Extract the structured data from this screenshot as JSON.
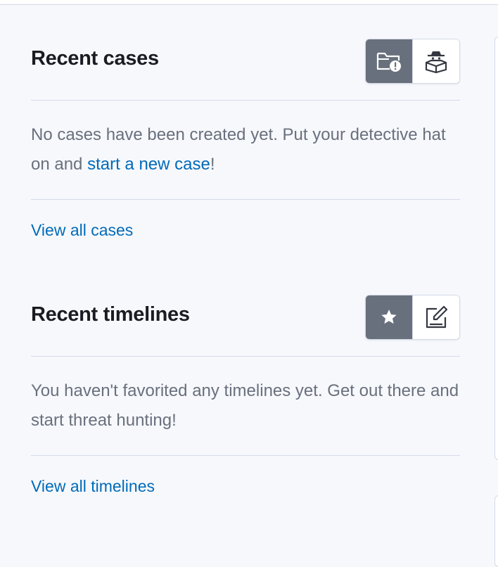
{
  "cases": {
    "title": "Recent cases",
    "buttons": [
      {
        "icon": "folder-exclamation-icon",
        "selected": true
      },
      {
        "icon": "detective-icon",
        "selected": false
      }
    ],
    "empty_text_before": "No cases have been created yet. Put your detective hat on and ",
    "empty_link": "start a new case",
    "empty_text_after": "!",
    "view_all": "View all cases"
  },
  "timelines": {
    "title": "Recent timelines",
    "buttons": [
      {
        "icon": "star-icon",
        "selected": true
      },
      {
        "icon": "edit-icon",
        "selected": false
      }
    ],
    "empty_text": "You haven't favorited any timelines yet. Get out there and start threat hunting!",
    "view_all": "View all timelines"
  },
  "colors": {
    "background": "#f7f8fc",
    "title": "#1a1c21",
    "text": "#69707d",
    "link": "#006bb8",
    "selected_button": "#69707d",
    "border": "#d3dae6"
  }
}
